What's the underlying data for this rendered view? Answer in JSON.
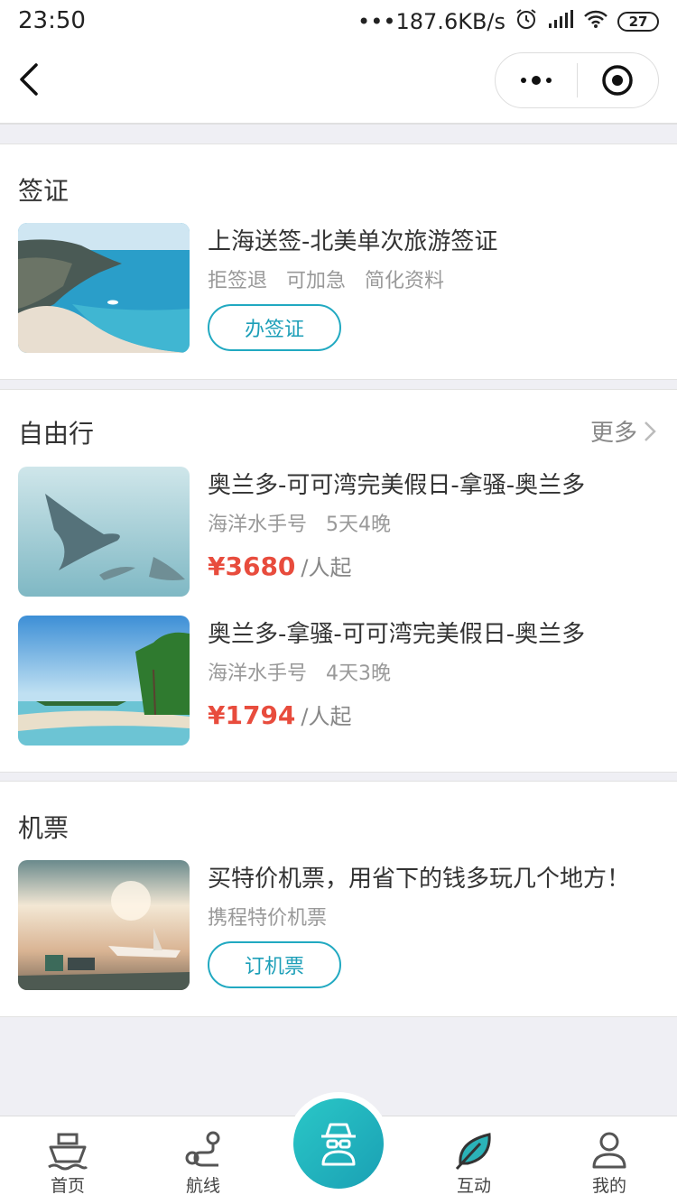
{
  "status_bar": {
    "time": "23:50",
    "network_speed": "•••187.6KB/s",
    "battery": "27"
  },
  "visa": {
    "title": "签证",
    "item": {
      "title": "上海送签-北美单次旅游签证",
      "tags": [
        "拒签退",
        "可加急",
        "简化资料"
      ],
      "button": "办签证"
    }
  },
  "free_travel": {
    "title": "自由行",
    "more": "更多",
    "items": [
      {
        "title": "奥兰多-可可湾完美假日-拿骚-奥兰多",
        "ship": "海洋水手号",
        "duration": "5天4晚",
        "price": "¥3680",
        "unit": "/人起"
      },
      {
        "title": "奥兰多-拿骚-可可湾完美假日-奥兰多",
        "ship": "海洋水手号",
        "duration": "4天3晚",
        "price": "¥1794",
        "unit": "/人起"
      }
    ]
  },
  "flights": {
    "title": "机票",
    "item": {
      "title": "买特价机票，用省下的钱多玩几个地方！",
      "subtitle": "携程特价机票",
      "button": "订机票"
    }
  },
  "tabbar": {
    "tabs": [
      {
        "label": "首页",
        "icon": "ship-icon"
      },
      {
        "label": "航线",
        "icon": "route-icon"
      },
      {
        "label": "",
        "icon": "incognito-icon"
      },
      {
        "label": "互动",
        "icon": "leaf-icon"
      },
      {
        "label": "我的",
        "icon": "user-icon"
      }
    ]
  },
  "colors": {
    "accent": "#21a9c1",
    "price": "#e84c3d",
    "background": "#efeff4"
  }
}
